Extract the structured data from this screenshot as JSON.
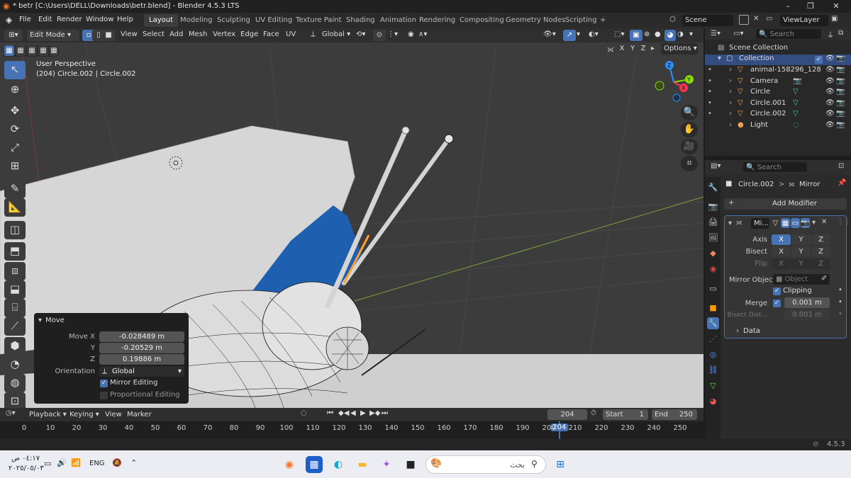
{
  "window": {
    "title": "* betr [C:\\Users\\DELL\\Downloads\\betr.blend] - Blender 4.5.3 LTS",
    "min": "–",
    "max": "❐",
    "close": "✕"
  },
  "menus": [
    "File",
    "Edit",
    "Render",
    "Window",
    "Help"
  ],
  "workspaces": [
    "Layout",
    "Modeling",
    "Sculpting",
    "UV Editing",
    "Texture Paint",
    "Shading",
    "Animation",
    "Rendering",
    "Compositing",
    "Geometry Nodes",
    "Scripting"
  ],
  "workspace_add": "+",
  "scene": "Scene",
  "view_layer": "ViewLayer",
  "header": {
    "mode": "Edit Mode",
    "items": [
      "View",
      "Select",
      "Add",
      "Mesh",
      "Vertex",
      "Edge",
      "Face",
      "UV"
    ],
    "orientation": "Global"
  },
  "viewport": {
    "perspective": "User Perspective",
    "object_info": "(204) Circle.002 | Circle.002",
    "axes": [
      "X",
      "Y",
      "Z"
    ],
    "options": "Options"
  },
  "gizmo": {
    "z": "Z",
    "y": "Y",
    "x": "X"
  },
  "move_panel": {
    "title": "Move",
    "rows": [
      {
        "label": "Move X",
        "value": "-0.028489 m"
      },
      {
        "label": "Y",
        "value": "-0.20529 m"
      },
      {
        "label": "Z",
        "value": "0.19886 m"
      }
    ],
    "orientation_label": "Orientation",
    "orientation_value": "Global",
    "mirror_editing": "Mirror Editing",
    "proportional_editing": "Proportional Editing"
  },
  "outliner": {
    "search_placeholder": "Search",
    "root": "Scene Collection",
    "collection": "Collection",
    "items": [
      {
        "name": "animal-158296_128",
        "icon": "empty-image-icon"
      },
      {
        "name": "Camera",
        "icon": "camera-icon"
      },
      {
        "name": "Circle",
        "icon": "mesh-icon"
      },
      {
        "name": "Circle.001",
        "icon": "mesh-icon"
      },
      {
        "name": "Circle.002",
        "icon": "mesh-icon"
      },
      {
        "name": "Light",
        "icon": "light-icon"
      }
    ]
  },
  "properties": {
    "search_placeholder": "Search",
    "breadcrumb_object": "Circle.002",
    "breadcrumb_sep": ">",
    "breadcrumb_modifier": "Mirror",
    "add_modifier": "Add Modifier",
    "modifier_name": "Mi...",
    "axis_label": "Axis",
    "bisect_label": "Bisect",
    "flip_label": "Flip",
    "xyz": [
      "X",
      "Y",
      "Z"
    ],
    "mirror_object_label": "Mirror Object",
    "mirror_object_placeholder": "Object",
    "clipping": "Clipping",
    "merge_label": "Merge",
    "merge_value": "0.001 m",
    "bisect_distance_label": "Bisect Dist...",
    "bisect_distance_value": "0.001 m",
    "data": "Data"
  },
  "timeline": {
    "menus": [
      "Playback",
      "Keying",
      "View",
      "Marker"
    ],
    "current_frame": "204",
    "start_label": "Start",
    "start": "1",
    "end_label": "End",
    "end": "250",
    "ticks": [
      "0",
      "10",
      "20",
      "30",
      "40",
      "50",
      "60",
      "70",
      "80",
      "90",
      "100",
      "110",
      "120",
      "130",
      "140",
      "150",
      "160",
      "170",
      "180",
      "190",
      "200",
      "210",
      "220",
      "230",
      "240",
      "250"
    ],
    "playhead": "204"
  },
  "status": {
    "version": "4.5.3"
  },
  "taskbar": {
    "time": "٠٤:١٧ ص",
    "date": "٢٠٢٥/٠٥/٠٣",
    "lang": "ENG",
    "search_text": "بحث",
    "apps": [
      "blender-icon",
      "store-icon",
      "edge-icon",
      "explorer-icon",
      "copilot-icon",
      "app-icon"
    ]
  },
  "colors": {
    "accent": "#4772b3",
    "viewport_bg": "#3c3c3c",
    "mesh_white": "#d8d8d8",
    "x_axis": "#ff3352",
    "y_axis": "#8bdc00",
    "z_axis": "#2890ff",
    "selected_edge": "#ffa030"
  }
}
